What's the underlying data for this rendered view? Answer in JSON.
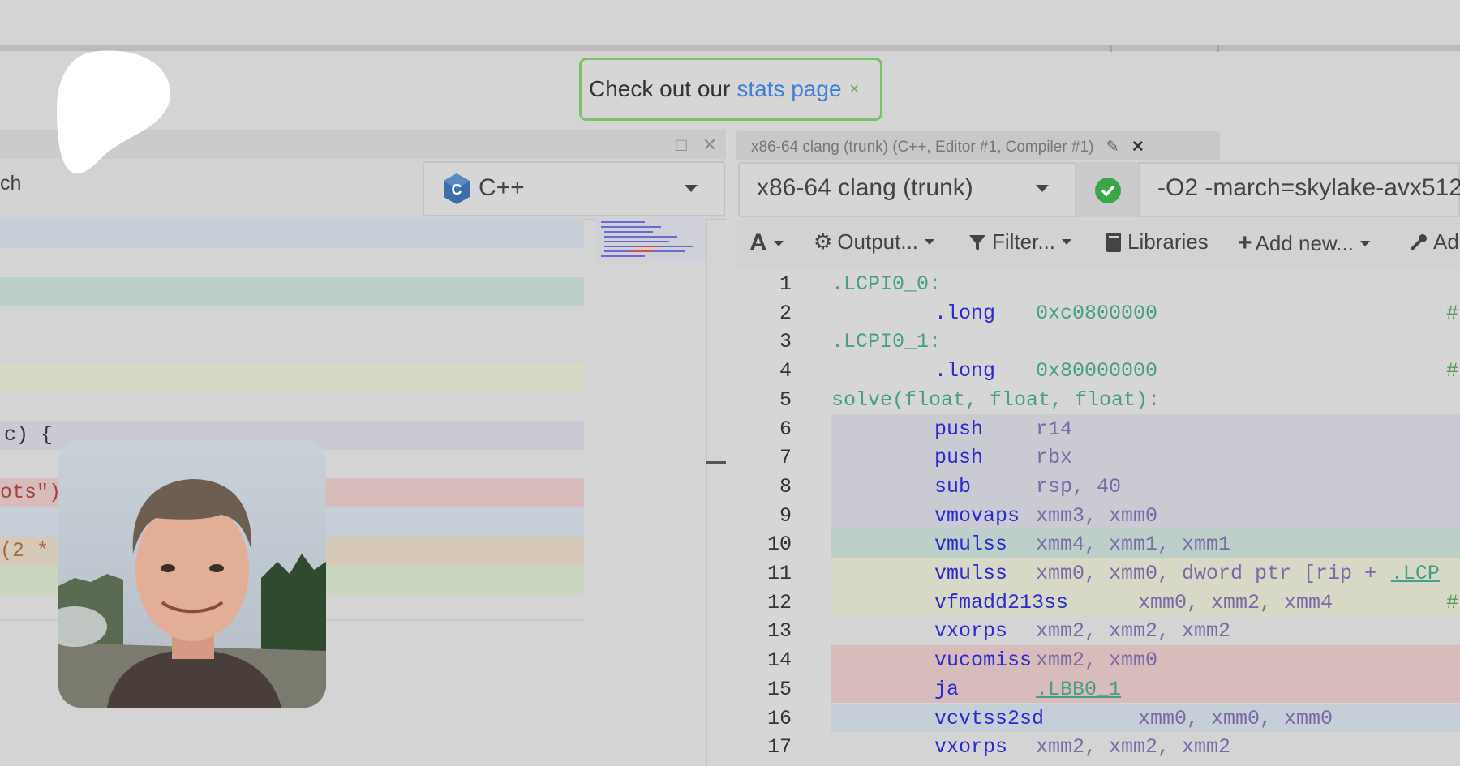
{
  "banner": {
    "prefix": "Check out our",
    "link": "stats page",
    "close": "×"
  },
  "left_editor": {
    "window_buttons": {
      "maximize": "□",
      "close": "✕"
    },
    "search_partial": "ch",
    "language": "C++",
    "code_fragments": [
      "c) {",
      "ots\")",
      "(2 *"
    ]
  },
  "right_panel": {
    "tab_title": "x86-64 clang (trunk) (C++, Editor #1, Compiler #1)",
    "tab_close": "✕",
    "compiler": "x86-64 clang (trunk)",
    "options": "-O2 -march=skylake-avx512",
    "toolbar": {
      "font": "A",
      "output": "Output...",
      "filter": "Filter...",
      "libraries": "Libraries",
      "add_new": "Add new...",
      "add_tool": "Ad"
    },
    "asm_lines": [
      {
        "n": "1",
        "label": ".LCPI0_0:"
      },
      {
        "n": "2",
        "op": ".long",
        "args": "0xc0800000",
        "comment": "#"
      },
      {
        "n": "3",
        "label": ".LCPI0_1:"
      },
      {
        "n": "4",
        "op": ".long",
        "args": "0x80000000",
        "comment": "#"
      },
      {
        "n": "5",
        "label": "solve(float, float, float):"
      },
      {
        "n": "6",
        "op": "push",
        "args": "r14"
      },
      {
        "n": "7",
        "op": "push",
        "args": "rbx"
      },
      {
        "n": "8",
        "op": "sub",
        "args": "rsp, 40"
      },
      {
        "n": "9",
        "op": "vmovaps",
        "args": "xmm3, xmm0"
      },
      {
        "n": "10",
        "op": "vmulss",
        "args": "xmm4, xmm1, xmm1"
      },
      {
        "n": "11",
        "op": "vmulss",
        "args": "xmm0, xmm0, dword ptr [rip + ",
        "link": ".LCP"
      },
      {
        "n": "12",
        "op": "vfmadd213ss",
        "args": "xmm0, xmm2, xmm4",
        "comment": "#"
      },
      {
        "n": "13",
        "op": "vxorps",
        "args": "xmm2, xmm2, xmm2"
      },
      {
        "n": "14",
        "op": "vucomiss",
        "args": "xmm2, xmm0"
      },
      {
        "n": "15",
        "op": "ja",
        "link": ".LBB0_1"
      },
      {
        "n": "16",
        "op": "vcvtss2sd",
        "args": "xmm0, xmm0, xmm0"
      },
      {
        "n": "17",
        "op": "vxorps",
        "args": "xmm2, xmm2, xmm2"
      }
    ]
  },
  "colors": {
    "green_border": "#7cc06a",
    "link_blue": "#3f7fd8",
    "hl_blue": "#c6cfd8",
    "hl_green": "#bccfc8",
    "hl_yellow": "#d8d8c6",
    "hl_purple": "#cacad2",
    "hl_red": "#d8bcbc",
    "hl_orange": "#d6c9b8",
    "hl_lime": "#c8d6c0"
  }
}
